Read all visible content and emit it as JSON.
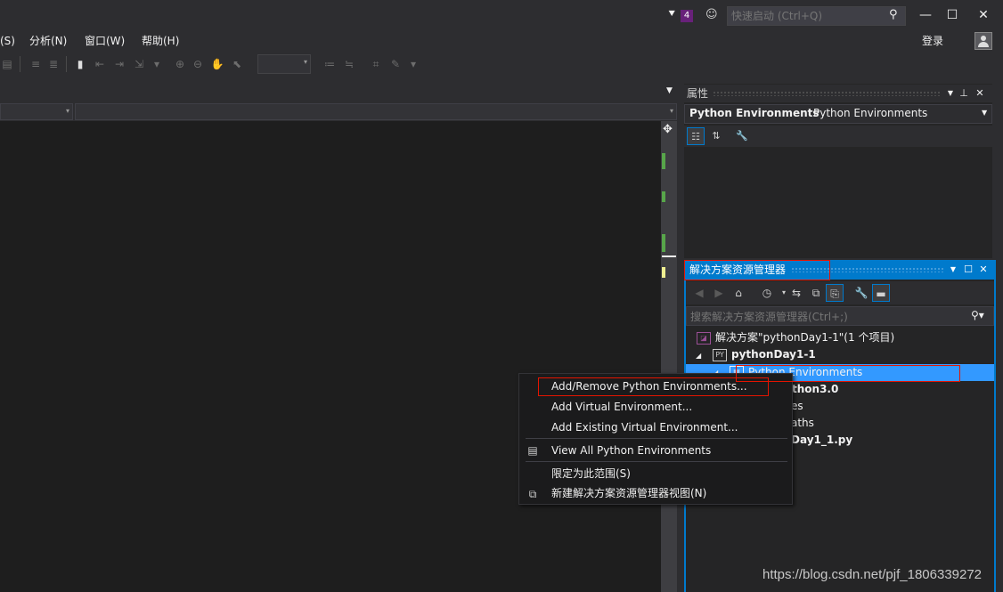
{
  "titlebar": {
    "notification_count": "4",
    "quick_launch_placeholder": "快速启动 (Ctrl+Q)"
  },
  "menu": {
    "items": [
      "(S)",
      "分析(N)",
      "窗口(W)",
      "帮助(H)"
    ],
    "login_label": "登录"
  },
  "properties": {
    "title": "属性",
    "object_name": "Python Environments",
    "object_type": "Python Environments"
  },
  "solution_explorer": {
    "title": "解决方案资源管理器",
    "search_placeholder": "搜索解决方案资源管理器(Ctrl+;)",
    "tree": [
      {
        "label": "解决方案\"pythonDay1-1\"(1 个项目)",
        "bold": false
      },
      {
        "label": "pythonDay1-1",
        "bold": true
      },
      {
        "label": "Python Environments",
        "bold": false,
        "selected": true
      },
      {
        "label": "thon3.0",
        "bold": true
      },
      {
        "label": "es",
        "bold": false
      },
      {
        "label": "aths",
        "bold": false
      },
      {
        "label": "Day1_1.py",
        "bold": true
      }
    ]
  },
  "context_menu": {
    "items": [
      "Add/Remove Python Environments...",
      "Add Virtual Environment...",
      "Add Existing Virtual Environment...",
      "View All Python Environments",
      "限定为此范围(S)",
      "新建解决方案资源管理器视图(N)"
    ]
  },
  "watermark": "https://blog.csdn.net/pjf_1806339272",
  "colors": {
    "accent": "#007acc",
    "selection": "#3399ff",
    "annotation": "#e51400",
    "badge": "#68217a"
  }
}
